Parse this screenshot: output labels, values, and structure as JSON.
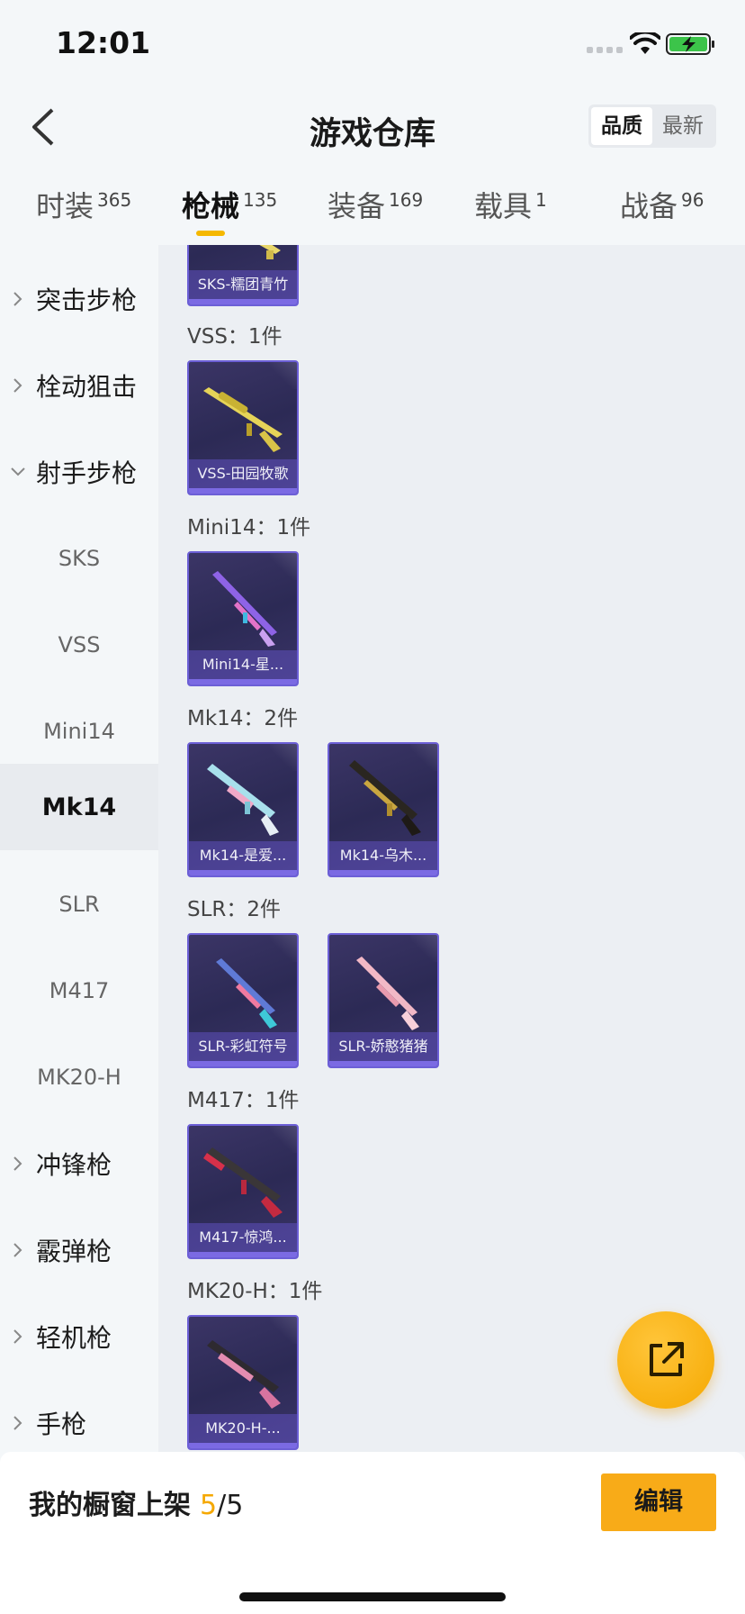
{
  "status": {
    "time": "12:01"
  },
  "header": {
    "title": "游戏仓库",
    "sort": {
      "quality": "品质",
      "newest": "最新"
    }
  },
  "tabs": [
    {
      "label": "时装",
      "count": "365"
    },
    {
      "label": "枪械",
      "count": "135"
    },
    {
      "label": "装备",
      "count": "169"
    },
    {
      "label": "载具",
      "count": "1"
    },
    {
      "label": "战备",
      "count": "96"
    }
  ],
  "sidebar": {
    "items": [
      {
        "label": "突击步枪"
      },
      {
        "label": "栓动狙击"
      },
      {
        "label": "射手步枪"
      },
      {
        "label": "SKS"
      },
      {
        "label": "VSS"
      },
      {
        "label": "Mini14"
      },
      {
        "label": "Mk14"
      },
      {
        "label": "SLR"
      },
      {
        "label": "M417"
      },
      {
        "label": "MK20-H"
      },
      {
        "label": "冲锋枪"
      },
      {
        "label": "霰弹枪"
      },
      {
        "label": "轻机枪"
      },
      {
        "label": "手枪"
      }
    ]
  },
  "groups": [
    {
      "label": "VSS：1件"
    },
    {
      "label": "Mini14：1件"
    },
    {
      "label": "Mk14：2件"
    },
    {
      "label": "SLR：2件"
    },
    {
      "label": "M417：1件"
    },
    {
      "label": "MK20-H：1件"
    }
  ],
  "items": [
    {
      "name": "SKS-糯团青竹"
    },
    {
      "name": "VSS-田园牧歌"
    },
    {
      "name": "Mini14-星..."
    },
    {
      "name": "Mk14-是爱..."
    },
    {
      "name": "Mk14-乌木..."
    },
    {
      "name": "SLR-彩虹符号"
    },
    {
      "name": "SLR-娇憨猪猪"
    },
    {
      "name": "M417-惊鸿..."
    },
    {
      "name": "MK20-H-..."
    }
  ],
  "footer": {
    "shelf_label": "我的橱窗上架",
    "shelf_current": "5",
    "shelf_total": "/5",
    "edit_label": "编辑"
  },
  "colors": {
    "accent": "#f5b800",
    "card_border": "#6c5fd6"
  }
}
